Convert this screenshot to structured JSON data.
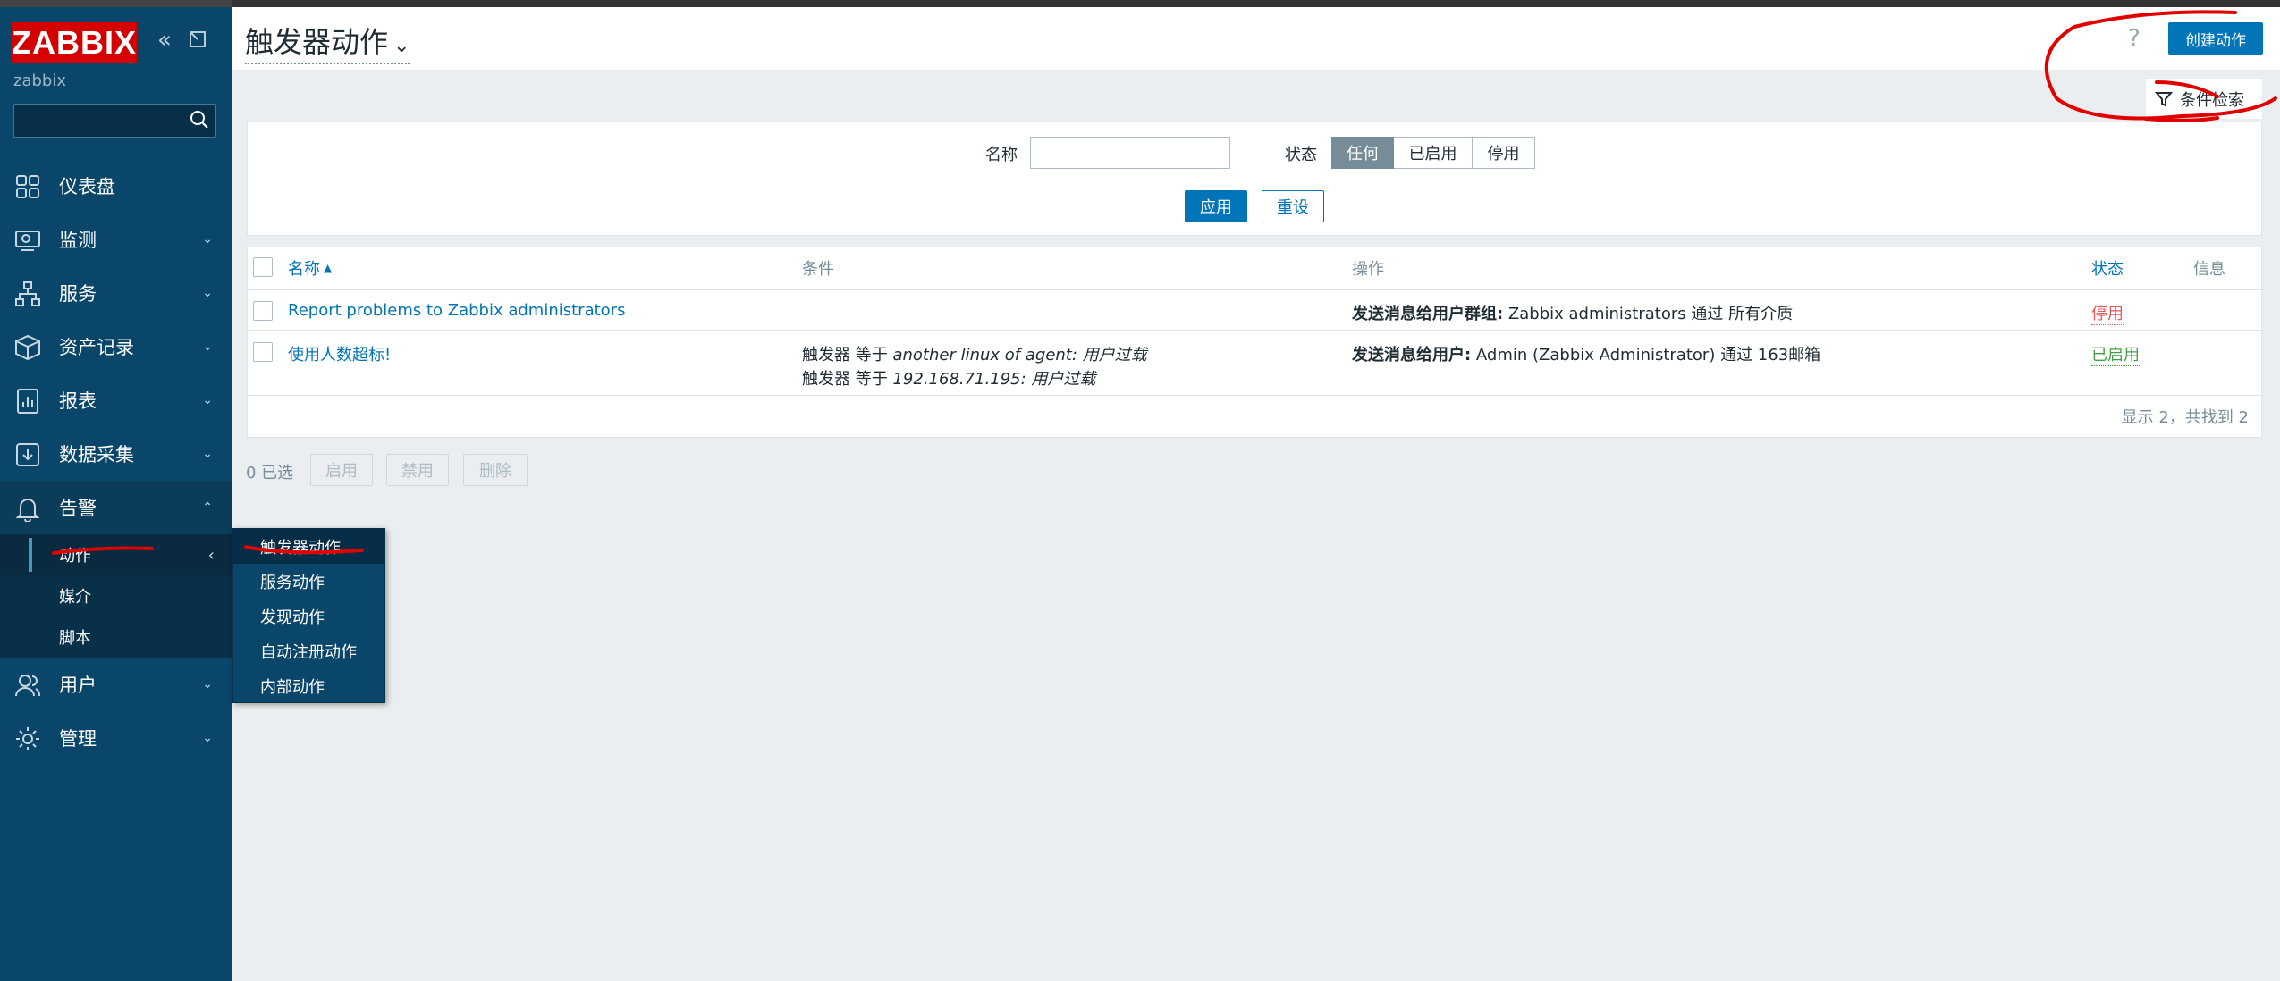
{
  "app": {
    "logo": "ZABBIX",
    "user": "zabbix",
    "search_placeholder": ""
  },
  "sidebar": {
    "items": [
      {
        "label": "仪表盘",
        "icon": "dashboard-icon"
      },
      {
        "label": "监测",
        "icon": "monitoring-icon"
      },
      {
        "label": "服务",
        "icon": "services-icon"
      },
      {
        "label": "资产记录",
        "icon": "inventory-icon"
      },
      {
        "label": "报表",
        "icon": "reports-icon"
      },
      {
        "label": "数据采集",
        "icon": "data-collection-icon"
      },
      {
        "label": "告警",
        "icon": "bell-icon"
      }
    ],
    "alerts_submenu": [
      {
        "label": "动作"
      },
      {
        "label": "媒介"
      },
      {
        "label": "脚本"
      }
    ],
    "bottom_items": [
      {
        "label": "用户",
        "icon": "users-icon"
      },
      {
        "label": "管理",
        "icon": "gear-icon"
      }
    ]
  },
  "flyout": {
    "items": [
      "触发器动作",
      "服务动作",
      "发现动作",
      "自动注册动作",
      "内部动作"
    ]
  },
  "header": {
    "title": "触发器动作",
    "help": "?",
    "create_button": "创建动作"
  },
  "filter": {
    "tab_label": "条件检索",
    "name_label": "名称",
    "name_value": "",
    "status_label": "状态",
    "status_options": [
      "任何",
      "已启用",
      "停用"
    ],
    "status_selected": "任何",
    "apply_label": "应用",
    "reset_label": "重设"
  },
  "table": {
    "headers": {
      "name": "名称",
      "conditions": "条件",
      "operations": "操作",
      "status": "状态",
      "info": "信息"
    },
    "rows": [
      {
        "name": "Report problems to Zabbix administrators",
        "conditions": [],
        "op_bold": "发送消息给用户群组:",
        "op_text": " Zabbix administrators 通过 所有介质",
        "status": "停用"
      },
      {
        "name": "使用人数超标!",
        "conditions": [
          {
            "prefix": "触发器 等于 ",
            "value": "another linux of agent: 用户过载"
          },
          {
            "prefix": "触发器 等于 ",
            "value": "192.168.71.195: 用户过载"
          }
        ],
        "op_bold": "发送消息给用户:",
        "op_text": " Admin (Zabbix Administrator) 通过 163邮箱",
        "status": "已启用"
      }
    ],
    "footer": "显示 2，共找到 2"
  },
  "actions": {
    "selected": "0 已选",
    "enable": "启用",
    "disable": "禁用",
    "delete": "删除"
  }
}
